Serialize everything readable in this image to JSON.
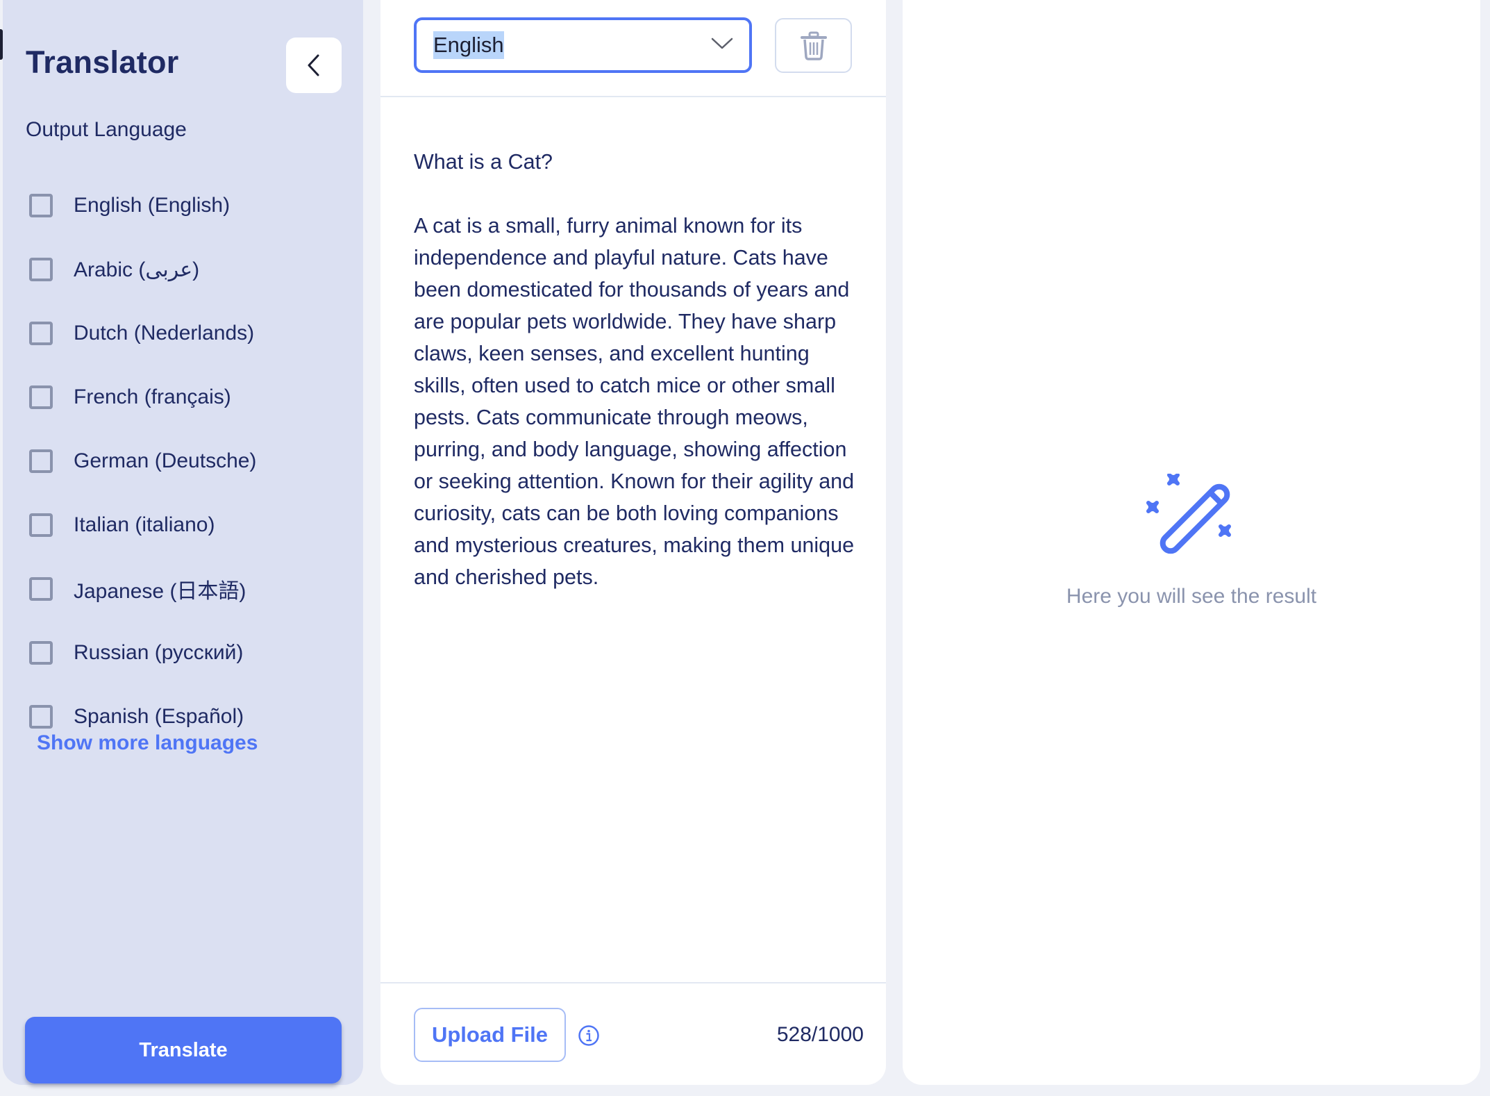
{
  "sidebar": {
    "title": "Translator",
    "back_icon": "chevron-left-icon",
    "section_label": "Output Language",
    "languages": [
      {
        "label": "English (English)",
        "checked": false
      },
      {
        "label": "Arabic (عربى)",
        "checked": false
      },
      {
        "label": "Dutch (Nederlands)",
        "checked": false
      },
      {
        "label": "French (français)",
        "checked": false
      },
      {
        "label": "German (Deutsche)",
        "checked": false
      },
      {
        "label": "Italian (italiano)",
        "checked": false
      },
      {
        "label": "Japanese (日本語)",
        "checked": false
      },
      {
        "label": "Russian (русский)",
        "checked": false
      },
      {
        "label": "Spanish (Español)",
        "checked": false
      }
    ],
    "show_more_label": "Show more languages",
    "translate_label": "Translate"
  },
  "input_panel": {
    "source_language": "English",
    "select_icon": "chevron-down-icon",
    "delete_icon": "trash-icon",
    "text": "What is a Cat?\n\nA cat is a small, furry animal known for its independence and playful nature. Cats have been domesticated for thousands of years and are popular pets worldwide. They have sharp claws, keen senses, and excellent hunting skills, often used to catch mice or other small pests. Cats communicate through meows, purring, and body language, showing affection or seeking attention. Known for their agility and curiosity, cats can be both loving companions and mysterious creatures, making them unique and cherished pets.",
    "upload_label": "Upload File",
    "info_icon": "info-icon",
    "char_count": "528/1000"
  },
  "result_panel": {
    "icon": "magic-wand-icon",
    "placeholder": "Here you will see the result"
  },
  "colors": {
    "accent": "#4f75f5",
    "sidebar_bg": "#dbe0f2",
    "text_primary": "#1f2a63",
    "text_muted": "#8a93ad",
    "page_bg": "#eff1f7"
  }
}
